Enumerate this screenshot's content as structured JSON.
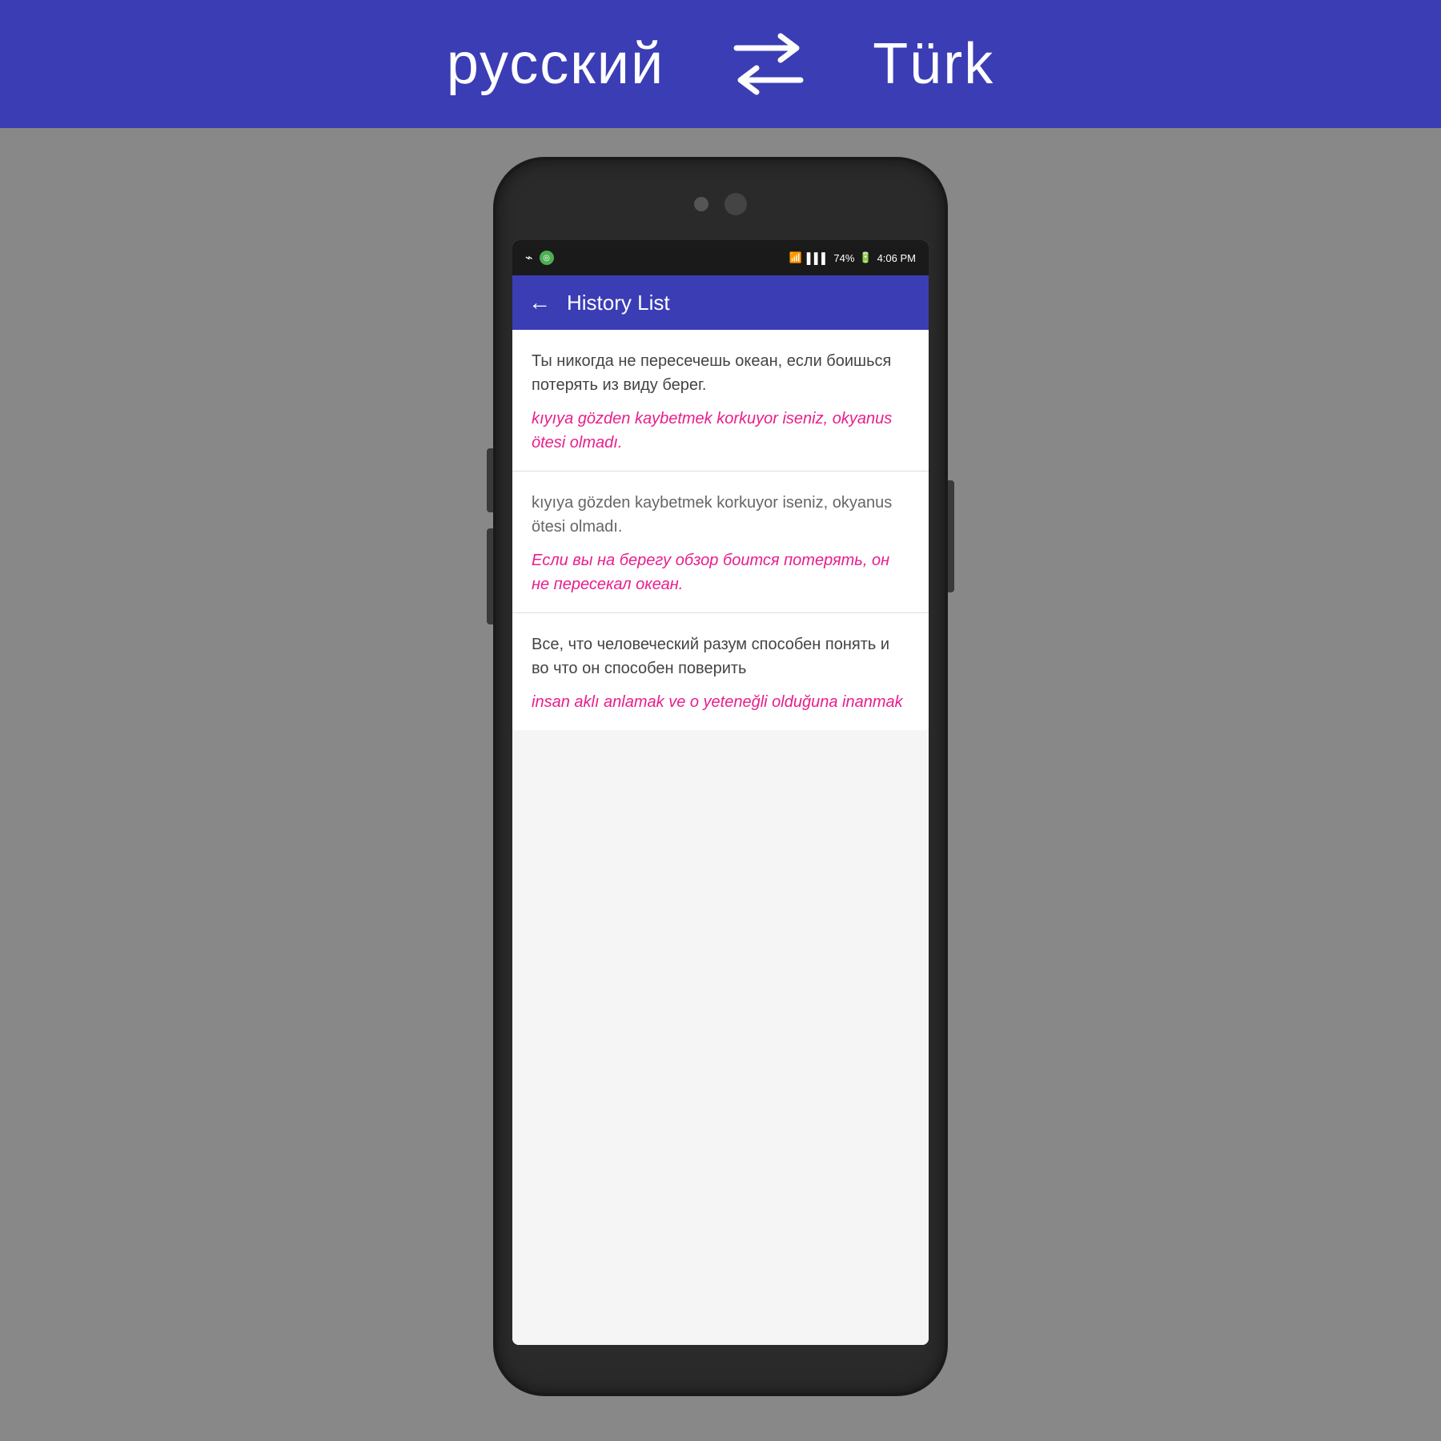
{
  "top_bar": {
    "lang_left": "русский",
    "lang_right": "Türk"
  },
  "status_bar": {
    "time": "4:06 PM",
    "battery": "74%",
    "signal": "●●●"
  },
  "app_bar": {
    "title": "History List",
    "back_label": "←"
  },
  "list_items": [
    {
      "id": 1,
      "original": "Ты никогда не пересечешь океан, если боишься потерять из виду берег.",
      "translation": "kıyıya gözden kaybetmek korkuyor iseniz, okyanus ötesi olmadı.",
      "translation_highlighted": true
    },
    {
      "id": 2,
      "original": "kıyıya gözden kaybetmek korkuyor iseniz, okyanus ötesi olmadı.",
      "translation": "Если вы на берегу обзор боится потерять, он не пересекал океан.",
      "translation_highlighted": true
    },
    {
      "id": 3,
      "original": "Все, что человеческий разум способен понять и во что он способен поверить",
      "translation": "insan aklı anlamak ve o yeteneğli olduğuna inanmak",
      "translation_highlighted": true
    }
  ]
}
